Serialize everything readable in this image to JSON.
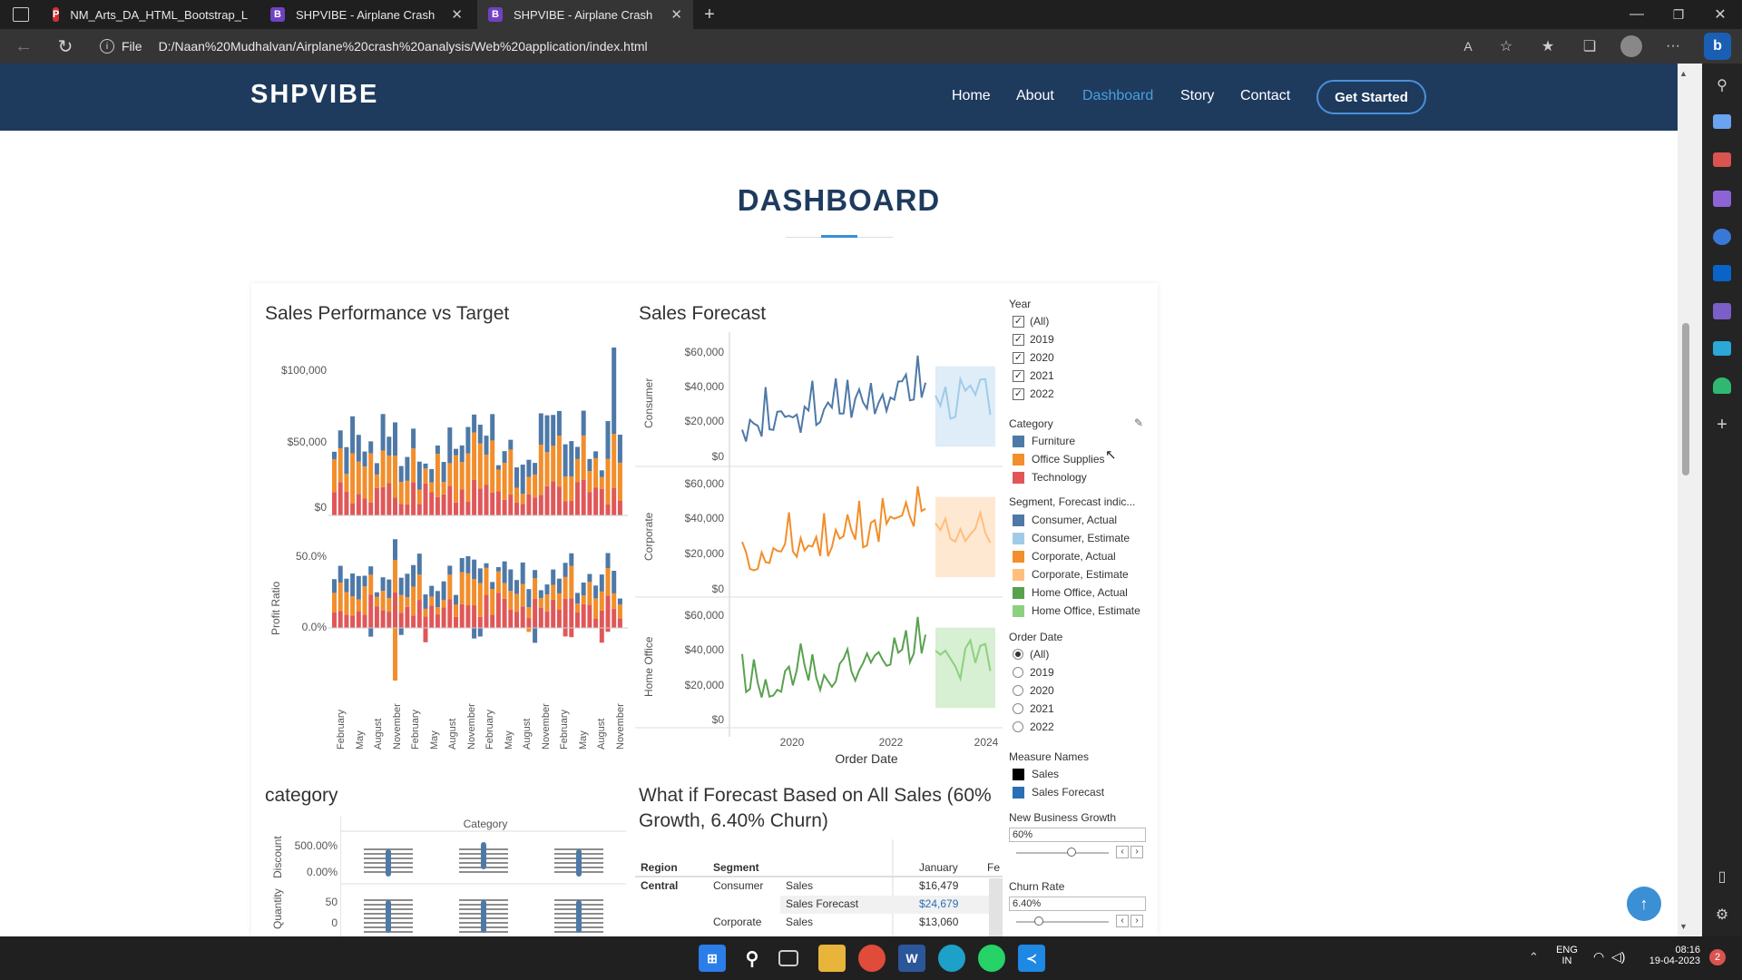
{
  "browser": {
    "tabs": [
      {
        "title": "NM_Arts_DA_HTML_Bootstrap_L",
        "icon": "pdf-icon"
      },
      {
        "title": "SHPVIBE - Airplane Crash",
        "icon": "bootstrap-icon"
      },
      {
        "title": "SHPVIBE - Airplane Crash",
        "icon": "bootstrap-icon"
      }
    ],
    "url_prefix": "File",
    "url": "D:/Naan%20Mudhalvan/Airplane%20crash%20analysis/Web%20application/index.html"
  },
  "site": {
    "logo": "SHPVIBE",
    "nav": [
      "Home",
      "About",
      "Dashboard",
      "Story",
      "Contact"
    ],
    "cta": "Get Started",
    "heading": "DASHBOARD",
    "active_color": "#4a9fe0"
  },
  "dashboard": {
    "perf_title": "Sales Performance vs Target",
    "perf_y_ticks": [
      "$100,000",
      "$50,000",
      "$0"
    ],
    "ratio_ticks": [
      "50.0%",
      "0.0%"
    ],
    "ratio_label": "Profit Ratio",
    "perf_x_ticks": [
      "February",
      "May",
      "August",
      "November",
      "February",
      "May",
      "August",
      "November",
      "February",
      "May",
      "August",
      "November",
      "February",
      "May",
      "August",
      "November"
    ],
    "forecast_title": "Sales Forecast",
    "forecast_y_ticks": [
      "$60,000",
      "$40,000",
      "$20,000",
      "$0"
    ],
    "forecast_rows": [
      "Consumer",
      "Corporate",
      "Home Office"
    ],
    "forecast_x_ticks": [
      "2020",
      "2022",
      "2024"
    ],
    "forecast_xlabel": "Order Date",
    "category_title": "category",
    "category_header": "Category",
    "category_ticks_top": [
      "500.00%",
      "0.00%"
    ],
    "category_label_top": "Discount",
    "category_ticks_bottom": [
      "50",
      "0"
    ],
    "category_label_bottom": "Quantity",
    "whatif_title_1": "What if Forecast Based on All Sales (60%",
    "whatif_title_2": "Growth, 6.40% Churn)",
    "table": {
      "headers": [
        "Region",
        "Segment",
        "January",
        "Fe"
      ],
      "region": "Central",
      "rows": [
        {
          "segment": "Consumer",
          "measure": "Sales",
          "value": "$16,479"
        },
        {
          "segment": "",
          "measure": "Sales Forecast",
          "value": "$24,679"
        },
        {
          "segment": "Corporate",
          "measure": "Sales",
          "value": "$13,060"
        }
      ]
    }
  },
  "filters": {
    "year_title": "Year",
    "years": [
      "(All)",
      "2019",
      "2020",
      "2021",
      "2022"
    ],
    "category_title": "Category",
    "categories": [
      {
        "name": "Furniture",
        "color": "#4e79a7"
      },
      {
        "name": "Office Supplies",
        "color": "#f28e2b"
      },
      {
        "name": "Technology",
        "color": "#e15759"
      }
    ],
    "segment_title": "Segment, Forecast indic...",
    "segments": [
      {
        "name": "Consumer, Actual",
        "color": "#4e79a7"
      },
      {
        "name": "Consumer, Estimate",
        "color": "#a0cbe8"
      },
      {
        "name": "Corporate, Actual",
        "color": "#f28e2b"
      },
      {
        "name": "Corporate, Estimate",
        "color": "#ffbe7d"
      },
      {
        "name": "Home Office, Actual",
        "color": "#59a14f"
      },
      {
        "name": "Home Office, Estimate",
        "color": "#8cd17d"
      }
    ],
    "orderdate_title": "Order Date",
    "orderdates": [
      "(All)",
      "2019",
      "2020",
      "2021",
      "2022"
    ],
    "measure_title": "Measure Names",
    "measures": [
      {
        "name": "Sales",
        "color": "#000000"
      },
      {
        "name": "Sales Forecast",
        "color": "#2a6fb5"
      }
    ],
    "growth_title": "New Business Growth",
    "growth_value": "60%",
    "churn_title": "Churn Rate",
    "churn_value": "6.40%"
  },
  "taskbar": {
    "lang1": "ENG",
    "lang2": "IN",
    "time": "08:16",
    "date": "19-04-2023",
    "notif_count": "2"
  }
}
